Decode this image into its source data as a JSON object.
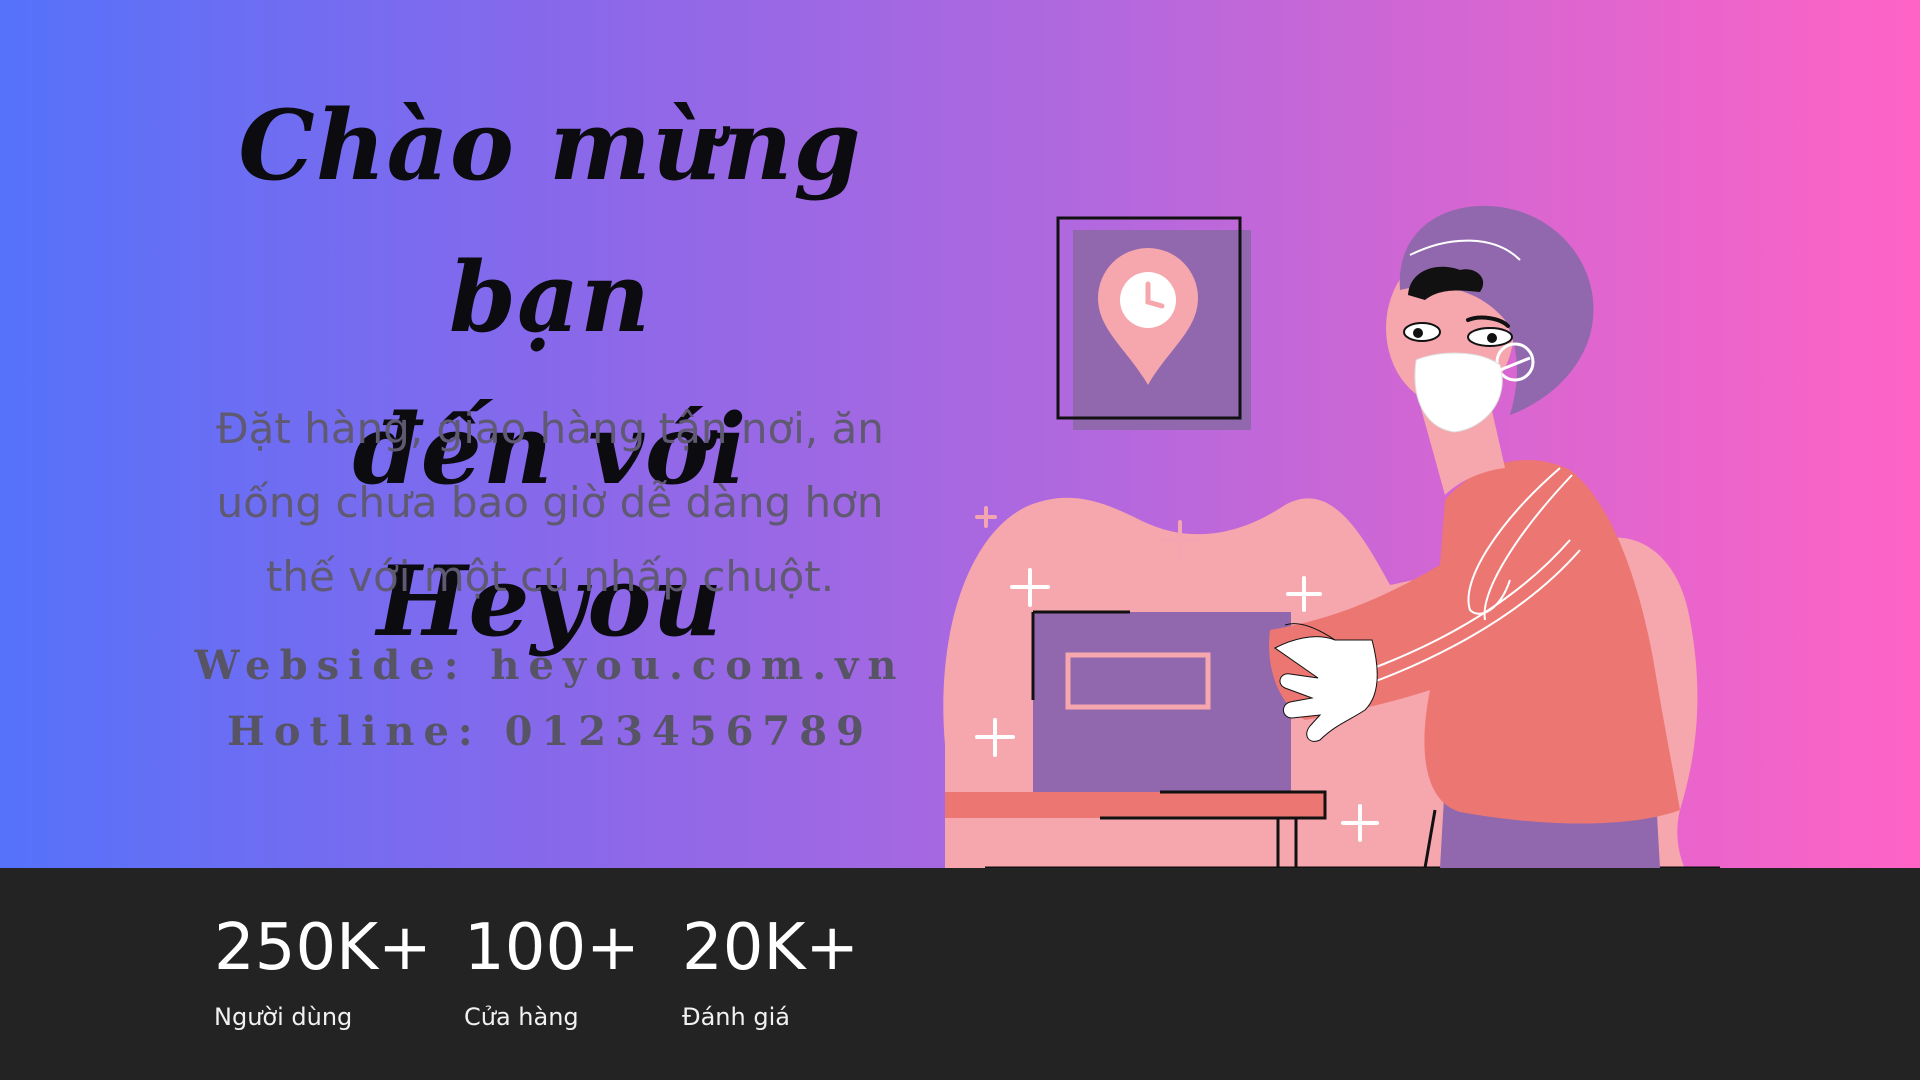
{
  "hero": {
    "headline_line1": "Chào mừng bạn",
    "headline_line2": "đến với Heyou",
    "subtitle_line1": "Đặt hàng, giao hàng tận nơi, ăn",
    "subtitle_line2": "uống chưa bao giờ dễ dàng hơn",
    "subtitle_line3": "thế với một cú nhấp chuột.",
    "website": "Webside: heyou.com.vn",
    "hotline": "Hotline: 0123456789"
  },
  "stats": [
    {
      "value": "250K+",
      "label": "Người dùng"
    },
    {
      "value": "100+",
      "label": "Cửa hàng"
    },
    {
      "value": "20K+",
      "label": "Đánh giá"
    }
  ],
  "colors": {
    "gradient_start": "#5572fa",
    "gradient_end": "#ff63c5",
    "bar_background": "#232323",
    "accent_pink": "#f6a6ad",
    "accent_purple": "#9168ad",
    "jacket_coral": "#ec7672"
  },
  "icons": {
    "map_pin": "location-clock-pin-icon",
    "sparkle": "plus-sparkle-icon"
  }
}
